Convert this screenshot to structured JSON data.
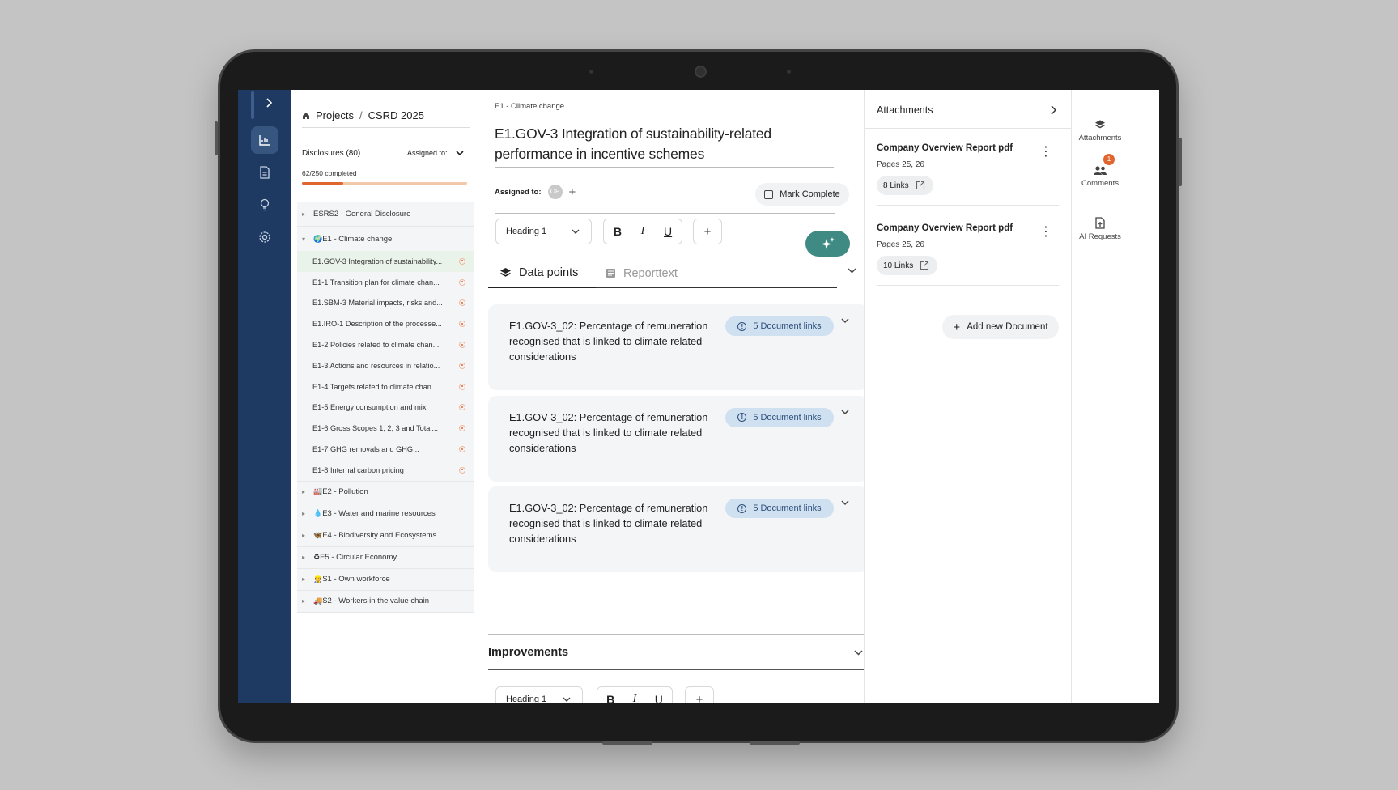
{
  "nav": {
    "expand_icon": "chevron-right-icon",
    "items": [
      "analytics-icon",
      "document-icon",
      "lightbulb-icon",
      "settings-icon"
    ]
  },
  "list": {
    "breadcrumb": [
      "Projects",
      "CSRD 2025"
    ],
    "disclosures_label": "Disclosures (80)",
    "assigned_label": "Assigned to:",
    "progress_text": "62/250 completed",
    "progress_fraction": 0.248,
    "groups_top": [
      {
        "label": "ESRS2 - General Disclosure"
      }
    ],
    "e1": {
      "label": "E1 - Climate change",
      "items": [
        "E1.GOV-3 Integration of sustainability...",
        "E1-1 Transition plan for climate chan...",
        "E1.SBM-3 Material impacts, risks and...",
        "E1.IRO-1 Description of the processe...",
        "E1-2 Policies related to climate chan...",
        "E1-3 Actions and resources in relatio...",
        "E1-4 Targets related to climate chan...",
        "E1-5 Energy consumption and mix",
        "E1-6 Gross Scopes 1, 2, 3 and Total...",
        "E1-7 GHG removals and GHG...",
        "E1-8 Internal carbon pricing"
      ]
    },
    "groups_bottom": [
      {
        "icon": "🏭",
        "label": "E2 - Pollution"
      },
      {
        "icon": "💧",
        "label": "E3 - Water and marine resources"
      },
      {
        "icon": "🦋",
        "label": "E4 - Biodiversity and Ecosystems"
      },
      {
        "icon": "♻",
        "label": "E5 - Circular Economy"
      },
      {
        "icon": "👷",
        "label": "S1 - Own workforce"
      },
      {
        "icon": "🚚",
        "label": "S2 - Workers in the value chain"
      }
    ]
  },
  "main": {
    "crumb": "E1 - Climate change",
    "title": "E1.GOV-3 Integration of sustainability-related performance in incentive schemes",
    "assigned_label": "Assigned to:",
    "avatar_initials": "OP",
    "mark_complete": "Mark Complete",
    "heading_select": "Heading 1",
    "bold": "B",
    "italic": "I",
    "underline": "U",
    "add": "+",
    "tabs": [
      {
        "label": "Data points"
      },
      {
        "label": "Reporttext"
      }
    ],
    "datapoints": [
      {
        "text": "E1.GOV-3_02: Percentage of remuneration recognised that is linked to climate related considerations",
        "chip": "5 Document links"
      },
      {
        "text": "E1.GOV-3_02: Percentage of remuneration recognised that is linked to climate related considerations",
        "chip": "5 Document links"
      },
      {
        "text": "E1.GOV-3_02: Percentage of remuneration recognised that is linked to climate related considerations",
        "chip": "5 Document links"
      }
    ],
    "improvements": "Improvements"
  },
  "attachments": {
    "title": "Attachments",
    "docs": [
      {
        "title": "Company Overview Report pdf",
        "pages": "Pages 25, 26",
        "links": "8 Links"
      },
      {
        "title": "Company Overview Report pdf",
        "pages": "Pages 25, 26",
        "links": "10 Links"
      }
    ],
    "add_doc": "Add new Document"
  },
  "rail": {
    "items": [
      {
        "label": "Attachments",
        "icon": "layers-icon"
      },
      {
        "label": "Comments",
        "icon": "people-icon",
        "badge": "1"
      },
      {
        "label": "AI Requests",
        "icon": "file-upload-icon"
      }
    ]
  },
  "colors": {
    "nav": "#1e3a63",
    "accent": "#e0662f",
    "ai_button": "#3f8a82",
    "chip": "#cfe0f1"
  }
}
